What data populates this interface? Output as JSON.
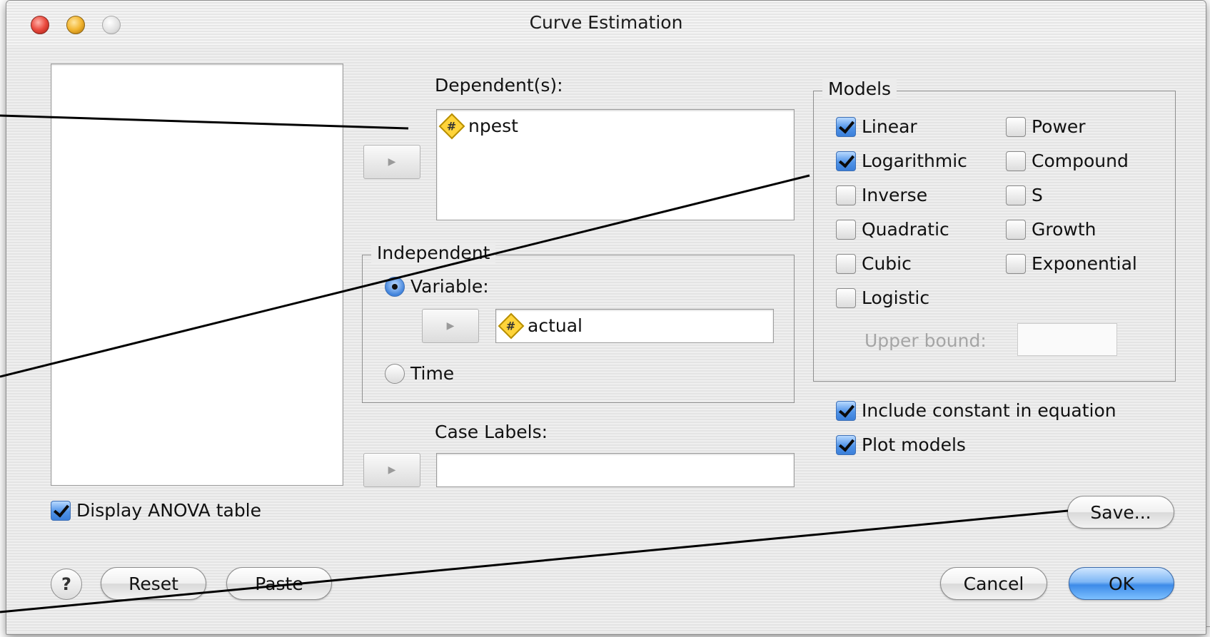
{
  "window": {
    "title": "Curve Estimation"
  },
  "dependent": {
    "label": "Dependent(s):",
    "items": [
      {
        "name": "npest",
        "icon": "numeric-variable-icon"
      }
    ]
  },
  "independent": {
    "legend": "Independent",
    "options": {
      "variable_label": "Variable:",
      "time_label": "Time",
      "selected": "variable"
    },
    "variable_value": "actual",
    "variable_icon": "numeric-variable-icon"
  },
  "case_labels": {
    "label": "Case Labels:",
    "value": ""
  },
  "models": {
    "legend": "Models",
    "items": [
      {
        "label": "Linear",
        "checked": true
      },
      {
        "label": "Power",
        "checked": false
      },
      {
        "label": "Logarithmic",
        "checked": true
      },
      {
        "label": "Compound",
        "checked": false
      },
      {
        "label": "Inverse",
        "checked": false
      },
      {
        "label": "S",
        "checked": false
      },
      {
        "label": "Quadratic",
        "checked": false
      },
      {
        "label": "Growth",
        "checked": false
      },
      {
        "label": "Cubic",
        "checked": false
      },
      {
        "label": "Exponential",
        "checked": false
      },
      {
        "label": "Logistic",
        "checked": false
      }
    ],
    "upper_bound_label": "Upper bound:",
    "upper_bound_value": ""
  },
  "options": {
    "include_constant": {
      "label": "Include constant in equation",
      "checked": true
    },
    "plot_models": {
      "label": "Plot models",
      "checked": true
    },
    "display_anova": {
      "label": "Display ANOVA table",
      "checked": true
    }
  },
  "buttons": {
    "help": "?",
    "reset": "Reset",
    "paste": "Paste",
    "save": "Save...",
    "cancel": "Cancel",
    "ok": "OK"
  },
  "colors": {
    "accent": "#3d8be8",
    "check_fill": "#4f93e8",
    "variable_icon": "#ffd43a"
  }
}
